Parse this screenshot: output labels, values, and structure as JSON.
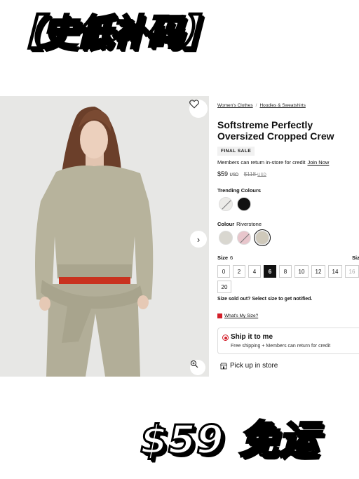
{
  "overlay": {
    "top_text": "【史低补码】",
    "bottom_text": "$59 免运"
  },
  "breadcrumb": [
    "Women's Clothes",
    "/",
    "Hoodies & Sweatshirts"
  ],
  "product": {
    "title": "Softstreme Perfectly Oversized Cropped Crew",
    "badge": "FINAL SALE",
    "members_text": "Members can return in-store for credit",
    "join_label": "Join Now",
    "price": "$59",
    "price_currency": "USD",
    "old_price": "$118",
    "old_price_currency": "USD"
  },
  "trending": {
    "label": "Trending Colours",
    "swatches": [
      {
        "name": "riverstone-strike",
        "color": "#ecebe8"
      },
      {
        "name": "black",
        "color": "#111111"
      }
    ]
  },
  "colour": {
    "label": "Colour",
    "value": "Riverstone",
    "swatches": [
      {
        "name": "light-grey",
        "color": "#d9d7d0"
      },
      {
        "name": "pink-strike",
        "color": "#e8c6cc"
      },
      {
        "name": "riverstone",
        "color": "#cfc9bb"
      }
    ]
  },
  "size": {
    "label": "Size",
    "value": "6",
    "cut_label": "Siz",
    "options": [
      {
        "label": "0",
        "state": "available"
      },
      {
        "label": "2",
        "state": "available"
      },
      {
        "label": "4",
        "state": "available"
      },
      {
        "label": "6",
        "state": "selected"
      },
      {
        "label": "8",
        "state": "available"
      },
      {
        "label": "10",
        "state": "available"
      },
      {
        "label": "12",
        "state": "available"
      },
      {
        "label": "14",
        "state": "available"
      },
      {
        "label": "16",
        "state": "out"
      }
    ],
    "options_row2": [
      {
        "label": "20",
        "state": "available"
      }
    ],
    "soldout_text": "Size sold out? Select size to get notified.",
    "guide_label": "What's My Size?"
  },
  "delivery": {
    "ship_title": "Ship it to me",
    "ship_sub": "Free shipping + Members can return for credit",
    "pickup_label": "Pick up in store"
  },
  "colors": {
    "accent_red": "#d31f2a",
    "sweater": "#b7b39c",
    "background": "#e7e7e5"
  },
  "icons": {
    "wishlist": "heart-icon",
    "next": "chevron-right-icon",
    "zoom": "zoom-in-icon",
    "store": "store-icon"
  }
}
